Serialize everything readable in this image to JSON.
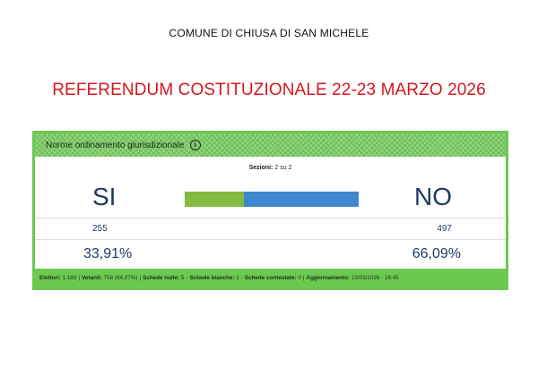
{
  "header": {
    "comune": "COMUNE DI CHIUSA DI SAN MICHELE",
    "title": "REFERENDUM COSTITUZIONALE 22-23 MARZO 2026"
  },
  "card": {
    "heading": "Norme ordinamento giurisdizionale",
    "info_icon": "i",
    "sezioni_label": "Sezioni:",
    "sezioni_value": "2 su 2",
    "si": {
      "label": "SI",
      "votes": "255",
      "percent": "33,91%"
    },
    "no": {
      "label": "NO",
      "votes": "497",
      "percent": "66,09%"
    },
    "bar": {
      "si_fraction": 0.3391,
      "no_fraction": 0.6609,
      "si_color": "#84ba3d",
      "no_color": "#3f86d1"
    },
    "footer": {
      "elettori_label": "Elettori:",
      "elettori_value": "1.183",
      "votanti_label": "Votanti:",
      "votanti_value": "758 (64,07%)",
      "nulle_label": "Schede nulle:",
      "nulle_value": "5",
      "bianche_label": "Schede bianche:",
      "bianche_value": "1",
      "contestate_label": "Schede contestate:",
      "contestate_value": "0",
      "aggiornamento_label": "Aggiornamento:",
      "aggiornamento_value": "23/03/2026 - 16:45",
      "separator": "|",
      "dash": "-"
    }
  },
  "colors": {
    "title": "#d4171c",
    "accent_green": "#6cc94f",
    "text_blue": "#1e3a63"
  }
}
